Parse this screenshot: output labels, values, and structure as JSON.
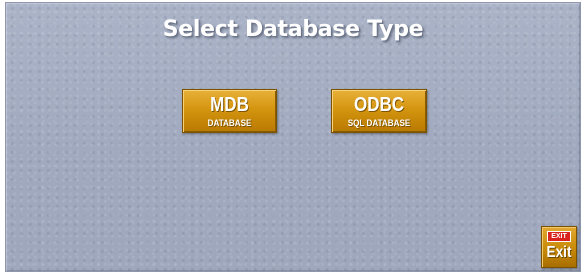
{
  "dialog": {
    "title": "Select Database Type"
  },
  "buttons": {
    "mdb": {
      "label": "MDB",
      "sublabel": "DATABASE"
    },
    "odbc": {
      "label": "ODBC",
      "sublabel": "SQL DATABASE"
    },
    "exit": {
      "sign_text": "EXIT",
      "label": "Exit",
      "icon": "exit-sign-icon"
    }
  },
  "colors": {
    "panel_background": "#a3acc1",
    "button_gold": "#d49510",
    "exit_sign_red": "#d8241c",
    "text": "#ffffff"
  }
}
